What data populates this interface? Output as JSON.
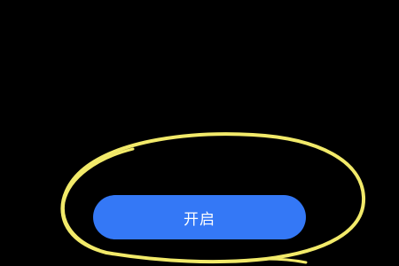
{
  "main": {
    "enable_button_label": "开启"
  },
  "colors": {
    "background": "#000000",
    "button_fill": "#3478f6",
    "button_text": "#ffffff",
    "annotation_stroke": "#f2ea6a"
  }
}
